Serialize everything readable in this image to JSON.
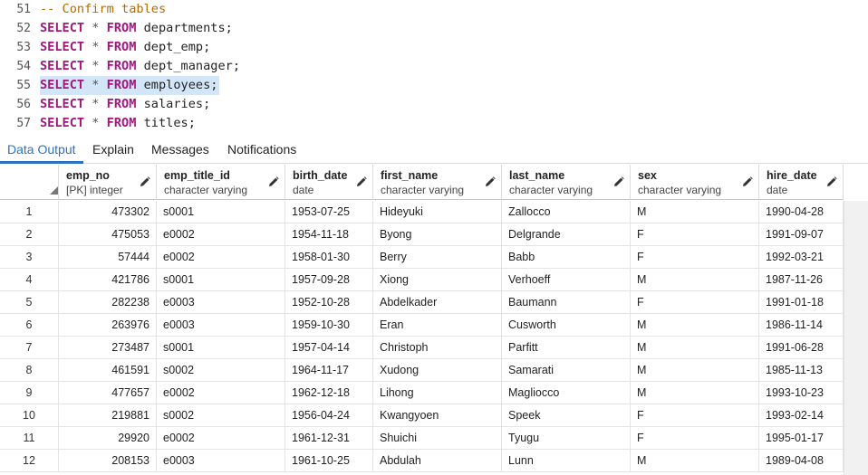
{
  "editor": {
    "lines": [
      {
        "num": "51",
        "comment": "-- Confirm tables"
      },
      {
        "num": "52",
        "kw1": "SELECT",
        "star": "*",
        "kw2": "FROM",
        "rest": "departments;"
      },
      {
        "num": "53",
        "kw1": "SELECT",
        "star": "*",
        "kw2": "FROM",
        "rest": "dept_emp;"
      },
      {
        "num": "54",
        "kw1": "SELECT",
        "star": "*",
        "kw2": "FROM",
        "rest": "dept_manager;"
      },
      {
        "num": "55",
        "kw1": "SELECT",
        "star": "*",
        "kw2": "FROM",
        "rest": "employees;",
        "selected": true
      },
      {
        "num": "56",
        "kw1": "SELECT",
        "star": "*",
        "kw2": "FROM",
        "rest": "salaries;"
      },
      {
        "num": "57",
        "kw1": "SELECT",
        "star": "*",
        "kw2": "FROM",
        "rest": "titles;"
      }
    ]
  },
  "tabs": [
    {
      "label": "Data Output",
      "active": true
    },
    {
      "label": "Explain"
    },
    {
      "label": "Messages"
    },
    {
      "label": "Notifications"
    }
  ],
  "grid": {
    "columns": [
      {
        "name": "emp_no",
        "type": "[PK] integer",
        "align": "right"
      },
      {
        "name": "emp_title_id",
        "type": "character varying"
      },
      {
        "name": "birth_date",
        "type": "date"
      },
      {
        "name": "first_name",
        "type": "character varying"
      },
      {
        "name": "last_name",
        "type": "character varying"
      },
      {
        "name": "sex",
        "type": "character varying"
      },
      {
        "name": "hire_date",
        "type": "date"
      }
    ],
    "rows": [
      {
        "n": "1",
        "cells": [
          "473302",
          "s0001",
          "1953-07-25",
          "Hideyuki",
          "Zallocco",
          "M",
          "1990-04-28"
        ]
      },
      {
        "n": "2",
        "cells": [
          "475053",
          "e0002",
          "1954-11-18",
          "Byong",
          "Delgrande",
          "F",
          "1991-09-07"
        ]
      },
      {
        "n": "3",
        "cells": [
          "57444",
          "e0002",
          "1958-01-30",
          "Berry",
          "Babb",
          "F",
          "1992-03-21"
        ]
      },
      {
        "n": "4",
        "cells": [
          "421786",
          "s0001",
          "1957-09-28",
          "Xiong",
          "Verhoeff",
          "M",
          "1987-11-26"
        ]
      },
      {
        "n": "5",
        "cells": [
          "282238",
          "e0003",
          "1952-10-28",
          "Abdelkader",
          "Baumann",
          "F",
          "1991-01-18"
        ]
      },
      {
        "n": "6",
        "cells": [
          "263976",
          "e0003",
          "1959-10-30",
          "Eran",
          "Cusworth",
          "M",
          "1986-11-14"
        ]
      },
      {
        "n": "7",
        "cells": [
          "273487",
          "s0001",
          "1957-04-14",
          "Christoph",
          "Parfitt",
          "M",
          "1991-06-28"
        ]
      },
      {
        "n": "8",
        "cells": [
          "461591",
          "s0002",
          "1964-11-17",
          "Xudong",
          "Samarati",
          "M",
          "1985-11-13"
        ]
      },
      {
        "n": "9",
        "cells": [
          "477657",
          "e0002",
          "1962-12-18",
          "Lihong",
          "Magliocco",
          "M",
          "1993-10-23"
        ]
      },
      {
        "n": "10",
        "cells": [
          "219881",
          "s0002",
          "1956-04-24",
          "Kwangyoen",
          "Speek",
          "F",
          "1993-02-14"
        ]
      },
      {
        "n": "11",
        "cells": [
          "29920",
          "e0002",
          "1961-12-31",
          "Shuichi",
          "Tyugu",
          "F",
          "1995-01-17"
        ]
      },
      {
        "n": "12",
        "cells": [
          "208153",
          "e0003",
          "1961-10-25",
          "Abdulah",
          "Lunn",
          "M",
          "1989-04-08"
        ]
      }
    ]
  },
  "colors": {
    "keyword": "#a3157f",
    "comment": "#b36b00",
    "selection": "#d3e6f7",
    "active_tab": "#2a73c0"
  },
  "icons": {
    "column_edit": "pencil-icon",
    "select_all": "corner-triangle-icon"
  }
}
